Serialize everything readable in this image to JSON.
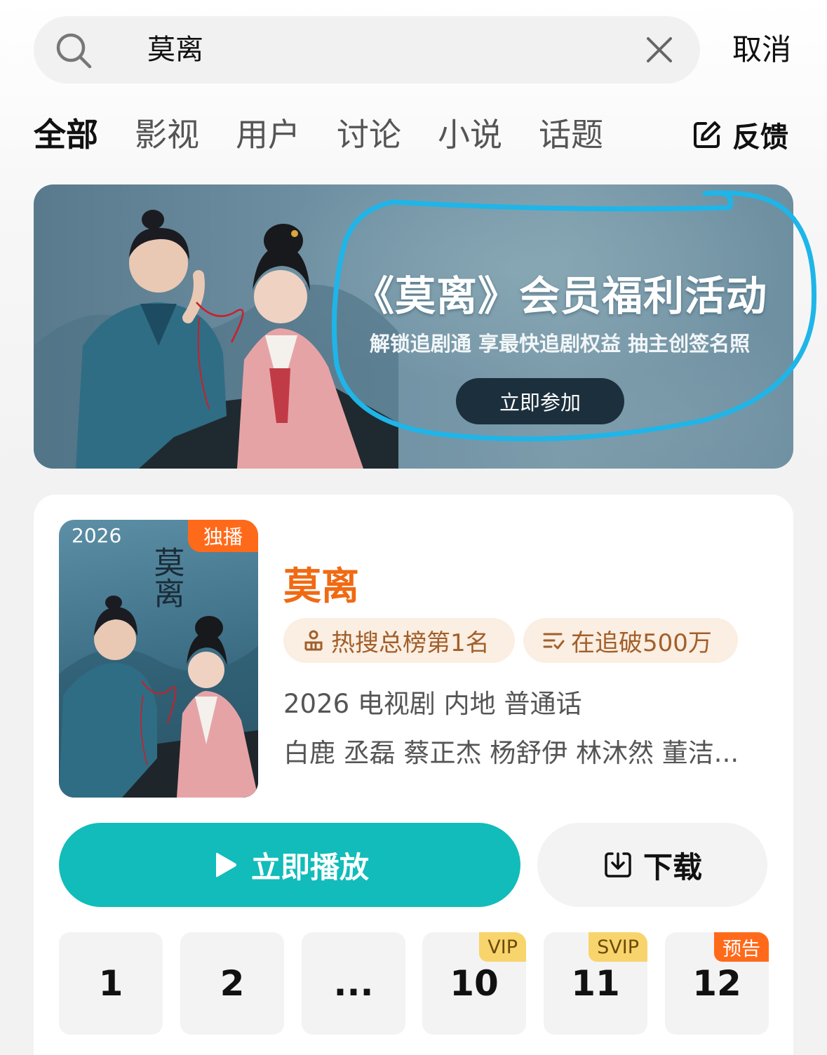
{
  "search": {
    "query": "莫离",
    "cancel_label": "取消"
  },
  "tabs": [
    {
      "label": "全部",
      "active": true
    },
    {
      "label": "影视"
    },
    {
      "label": "用户"
    },
    {
      "label": "讨论"
    },
    {
      "label": "小说"
    },
    {
      "label": "话题"
    }
  ],
  "feedback": {
    "label": "反馈"
  },
  "banner": {
    "title": "《莫离》会员福利活动",
    "subtitle": "解锁追剧通 享最快追剧权益 抽主创签名照",
    "button": "立即参加"
  },
  "result": {
    "poster_year": "2026",
    "poster_badge": "独播",
    "poster_title_art": "莫离",
    "title": "莫离",
    "tags": [
      "热搜总榜第1名",
      "在追破500万"
    ],
    "meta": "2026 电视剧 内地 普通话",
    "cast": "白鹿 丞磊 蔡正杰 杨舒伊 林沐然 董洁...",
    "play_label": "立即播放",
    "download_label": "下载",
    "episodes": [
      {
        "label": "1",
        "badge": ""
      },
      {
        "label": "2",
        "badge": ""
      },
      {
        "label": "...",
        "badge": ""
      },
      {
        "label": "10",
        "badge": "VIP"
      },
      {
        "label": "11",
        "badge": "SVIP"
      },
      {
        "label": "12",
        "badge": "预告"
      }
    ]
  },
  "colors": {
    "accent_teal": "#11bcba",
    "title_orange": "#f06a13",
    "badge_orange": "#ff6a1a",
    "vip_gold": "#f8d46c",
    "annotation_blue": "#1fb5e8"
  }
}
